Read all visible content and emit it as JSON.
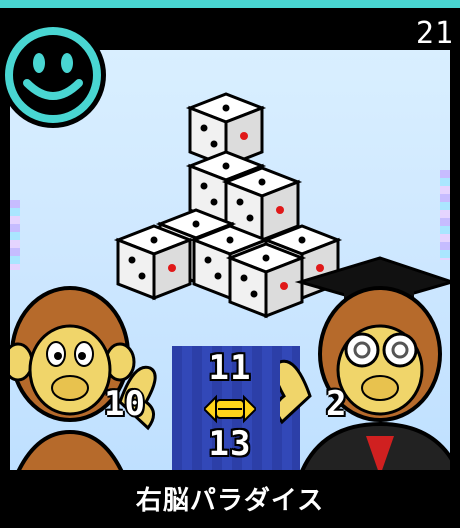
{
  "game": {
    "score": "21",
    "left_player_answer": "10",
    "right_player_answer": "2",
    "choice_top": "11",
    "choice_bottom": "13",
    "title": "右脳パラダイス"
  },
  "icons": {
    "status_face": "smiley-face-icon",
    "selector": "double-arrow-selector-icon"
  },
  "colors": {
    "accent_cyan": "#49d6d2",
    "sky": "#cfe8ff",
    "panel_blue": "#2f45b2",
    "selector_yellow": "#ffd41a",
    "monkey_fur": "#b66a2b",
    "monkey_face": "#f0d56a"
  }
}
